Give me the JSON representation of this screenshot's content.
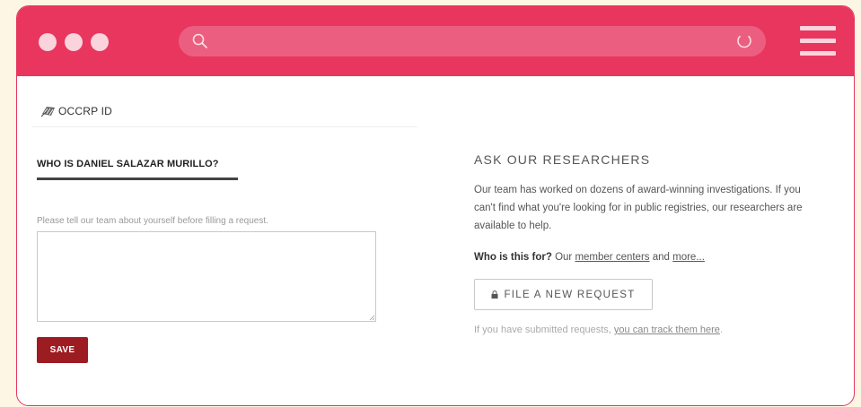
{
  "colors": {
    "titlebar": "#e8365f",
    "save_button": "#9c1c22",
    "page_background": "#fdf6e4"
  },
  "browser": {
    "icons": [
      "search-icon",
      "reload-icon",
      "hamburger-menu-icon"
    ]
  },
  "brand": {
    "name": "OCCRP ID",
    "icon": "occrp-logo-icon"
  },
  "profile": {
    "heading": "WHO IS DANIEL SALAZAR MURILLO?",
    "hint": "Please tell our team about yourself before filling a request.",
    "textarea_value": "",
    "save_label": "SAVE"
  },
  "researchers": {
    "heading": "ASK OUR RESEARCHERS",
    "description": "Our team has worked on dozens of award-winning investigations. If you can't find what you're looking for in public registries, our researchers are available to help.",
    "who_label": "Who is this for?",
    "who_text": " Our ",
    "member_centers_link": "member centers",
    "and_text": " and ",
    "more_link": "more...",
    "file_button_icon": "lock-icon",
    "file_button_label": "FILE A NEW REQUEST",
    "track_text": "If you have submitted requests, ",
    "track_link": "you can track them here",
    "track_end": "."
  }
}
